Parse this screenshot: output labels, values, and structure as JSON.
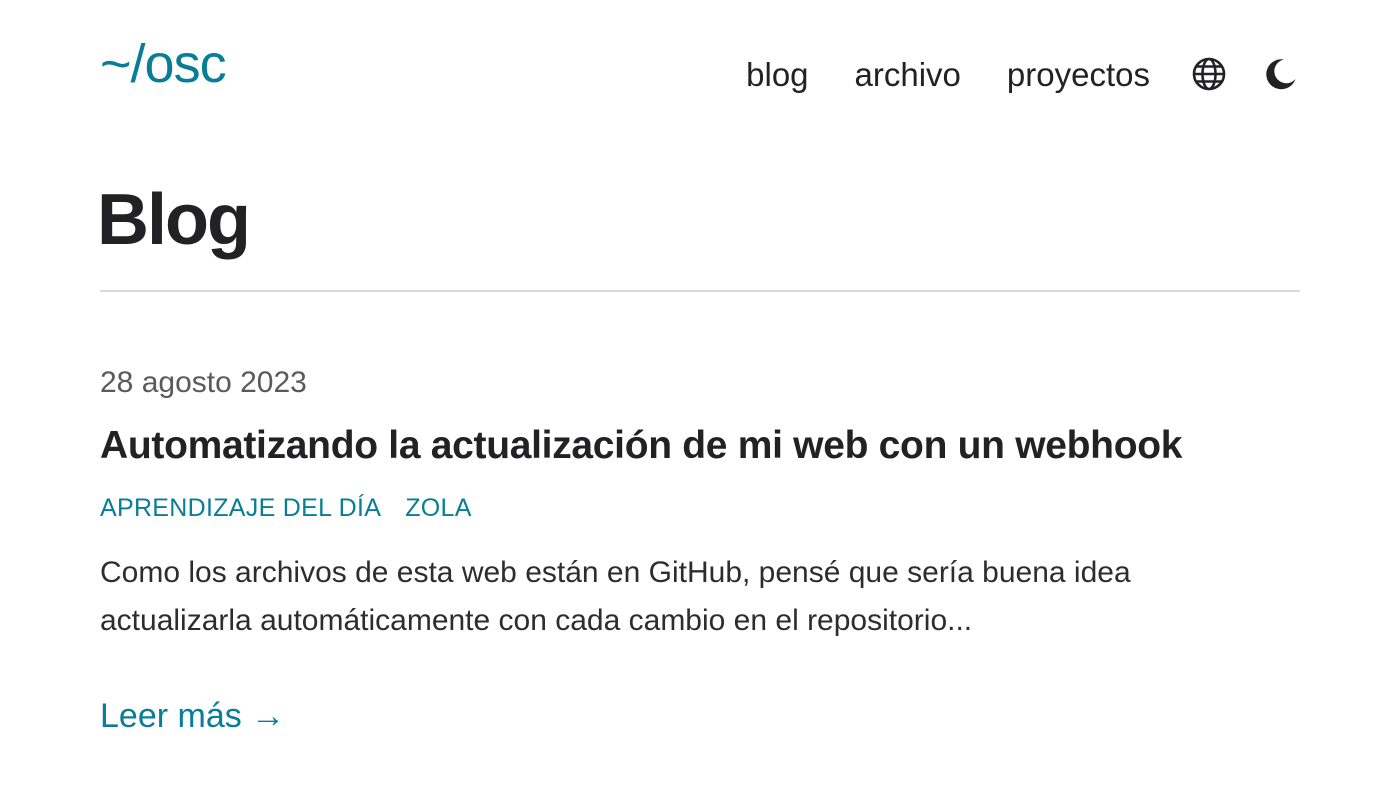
{
  "header": {
    "logo": "~/osc",
    "nav": [
      {
        "label": "blog"
      },
      {
        "label": "archivo"
      },
      {
        "label": "proyectos"
      }
    ],
    "icons": {
      "language": "globe-icon",
      "theme": "moon-icon"
    }
  },
  "main": {
    "title": "Blog",
    "posts": [
      {
        "date": "28 agosto 2023",
        "title": "Automatizando la actualización de mi web con un webhook",
        "tags": [
          "APRENDIZAJE DEL DÍA",
          "ZOLA"
        ],
        "summary": "Como los archivos de esta web están en GitHub, pensé que sería buena idea actualizarla automáticamente con cada cambio en el repositorio...",
        "read_more": "Leer más →"
      }
    ]
  },
  "colors": {
    "accent": "#087e96",
    "text": "#222226",
    "muted": "#5a5a5e",
    "divider": "#d9d9d9"
  }
}
